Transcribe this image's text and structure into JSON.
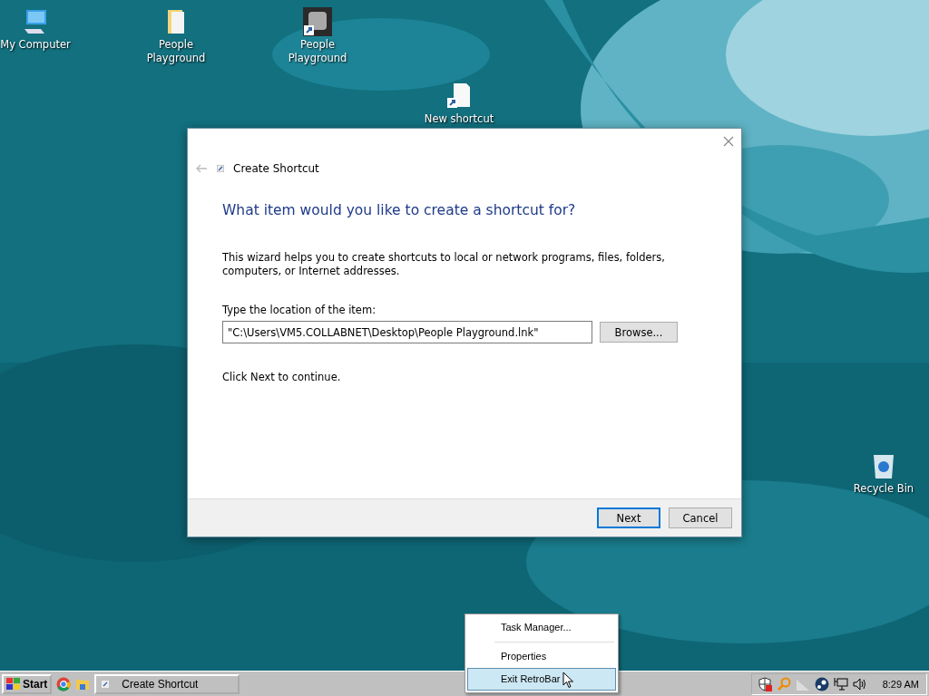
{
  "desktop_icons": [
    {
      "label": "My Computer",
      "kind": "computer"
    },
    {
      "label": "People Playground",
      "kind": "folder"
    },
    {
      "label": "People Playground",
      "kind": "app"
    },
    {
      "label": "New shortcut",
      "kind": "shortcut"
    },
    {
      "label": "Recycle Bin",
      "kind": "recycle"
    }
  ],
  "dialog": {
    "title": "Create Shortcut",
    "heading": "What item would you like to create a shortcut for?",
    "description": "This wizard helps you to create shortcuts to local or network programs, files, folders, computers, or Internet addresses.",
    "field_label": "Type the location of the item:",
    "location": "\"C:\\Users\\VM5.COLLABNET\\Desktop\\People Playground.lnk\"",
    "browse": "Browse...",
    "hint": "Click Next to continue.",
    "buttons": [
      {
        "label": "Next",
        "default": true
      },
      {
        "label": "Cancel",
        "default": false
      }
    ]
  },
  "context_menu": {
    "items": [
      {
        "kind": "item",
        "label": "Task Manager...",
        "selected": false
      },
      {
        "kind": "separator"
      },
      {
        "kind": "item",
        "label": "Properties",
        "selected": false
      },
      {
        "kind": "item",
        "label": "Exit RetroBar",
        "selected": true
      }
    ]
  },
  "taskbar": {
    "start": "Start",
    "tasks": [
      {
        "label": "Create Shortcut",
        "selected": false
      }
    ],
    "clock": "8:29 AM"
  }
}
